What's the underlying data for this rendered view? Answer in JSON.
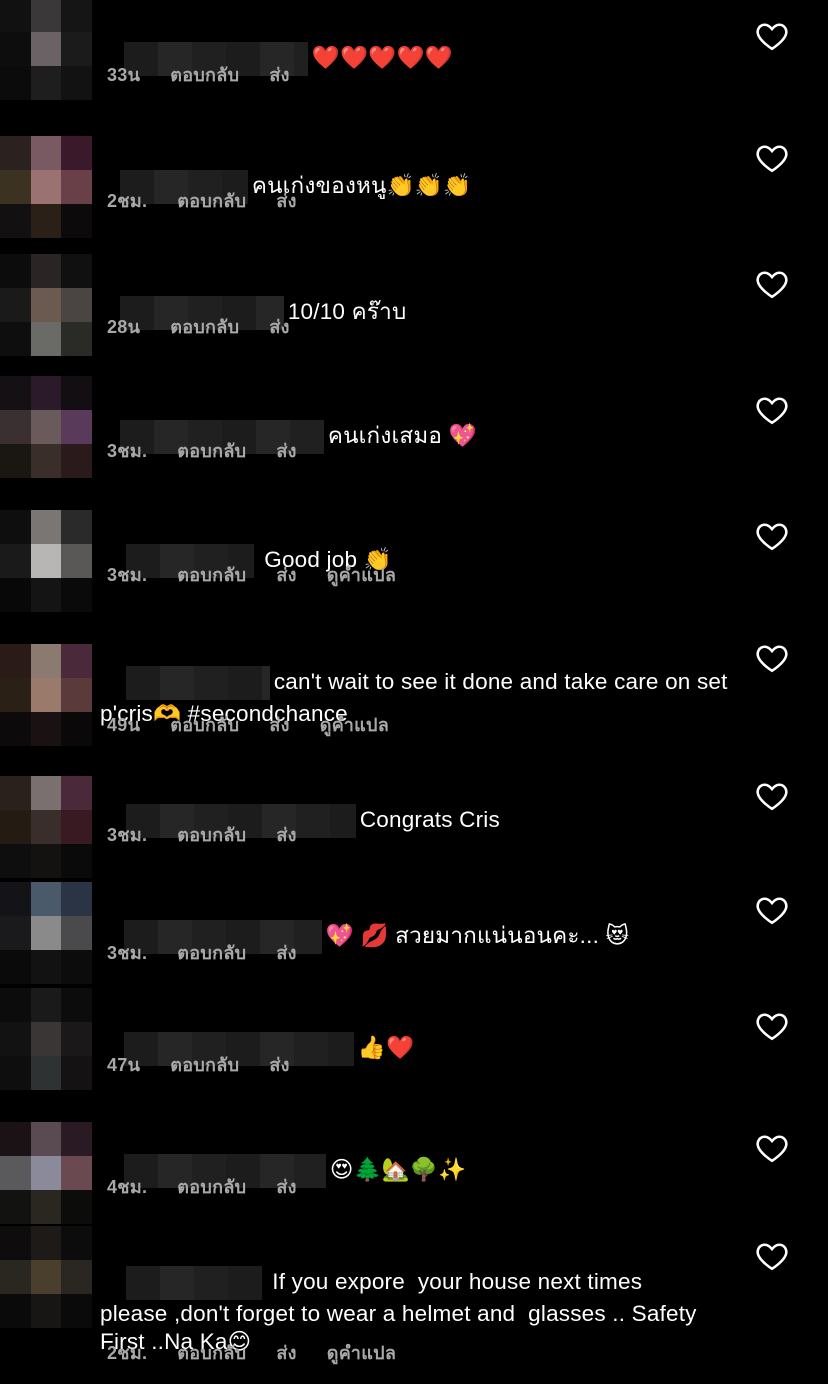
{
  "labels": {
    "reply": "ตอบกลับ",
    "send": "ส่ง",
    "translate": "ดูคำแปล"
  },
  "comments": [
    {
      "text": "❤️❤️❤️❤️❤️",
      "time": "33น",
      "translate": false
    },
    {
      "text": "คนเก่งของหนู👏👏👏",
      "time": "2ชม.",
      "translate": false
    },
    {
      "text": "10/10 คร๊าบ",
      "time": "28น",
      "translate": false
    },
    {
      "text": "คนเก่งเสมอ 💖",
      "time": "3ชม.",
      "translate": false
    },
    {
      "text": "Good job 👏",
      "time": "3ชม.",
      "translate": true
    },
    {
      "text": "can't wait to see it done and take care on set p'cris🫶 #secondchance",
      "time": "49น",
      "translate": true
    },
    {
      "text": "Congrats Cris",
      "time": "3ชม.",
      "translate": false
    },
    {
      "text": "💖 💋 สวยมากแน่นอนคะ... 😻",
      "time": "3ชม.",
      "translate": false
    },
    {
      "text": "👍❤️",
      "time": "47น",
      "translate": false
    },
    {
      "text": "😍🌲🏡🌳✨",
      "time": "4ชม.",
      "translate": false
    },
    {
      "text": "If you expore  your house next times please ,don't forget to wear a helmet and  glasses .. Safety First ..Na Ka😊",
      "time": "2ชม.",
      "translate": true
    }
  ]
}
